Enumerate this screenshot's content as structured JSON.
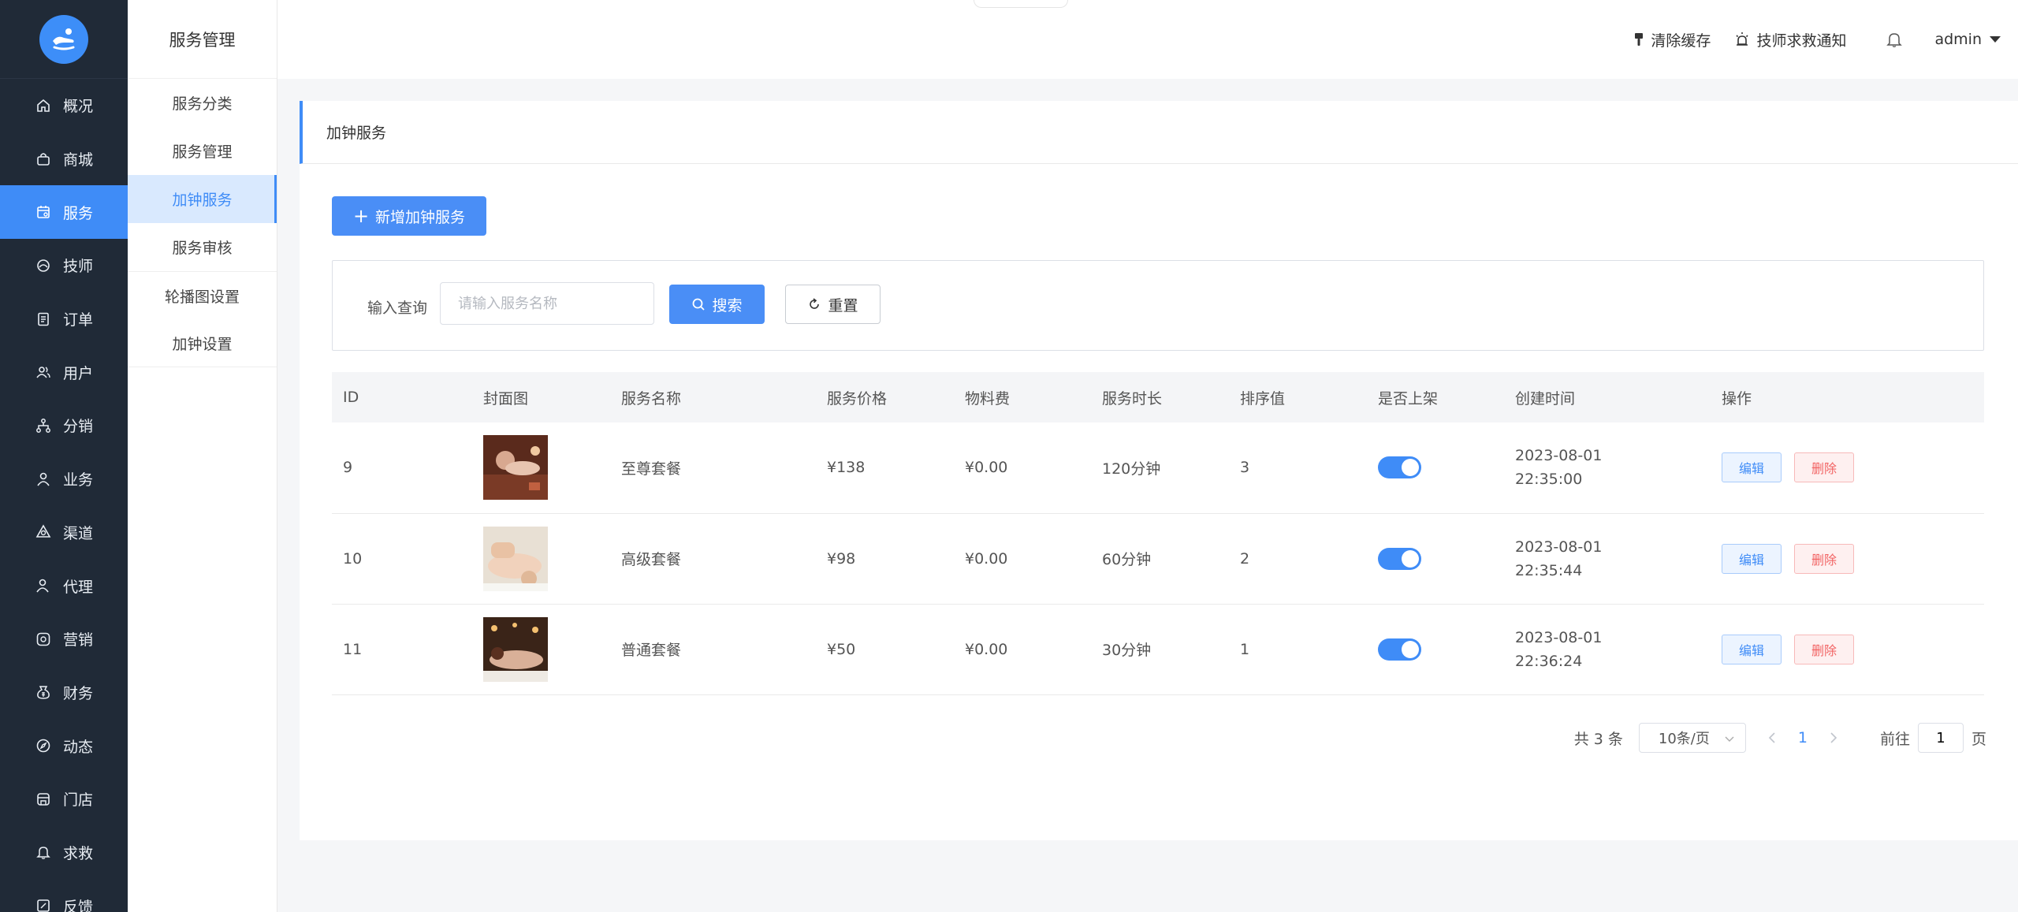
{
  "nav": {
    "items": [
      {
        "label": "概况",
        "icon": "home-icon"
      },
      {
        "label": "商城",
        "icon": "shop-bag-icon"
      },
      {
        "label": "服务",
        "icon": "service-calendar-icon"
      },
      {
        "label": "技师",
        "icon": "technician-icon"
      },
      {
        "label": "订单",
        "icon": "order-document-icon"
      },
      {
        "label": "用户",
        "icon": "users-icon"
      },
      {
        "label": "分销",
        "icon": "distribution-tree-icon"
      },
      {
        "label": "业务",
        "icon": "person-icon"
      },
      {
        "label": "渠道",
        "icon": "channel-icon"
      },
      {
        "label": "代理",
        "icon": "agent-icon"
      },
      {
        "label": "营销",
        "icon": "marketing-icon"
      },
      {
        "label": "财务",
        "icon": "finance-bag-icon"
      },
      {
        "label": "动态",
        "icon": "compass-icon"
      },
      {
        "label": "门店",
        "icon": "store-icon"
      },
      {
        "label": "求救",
        "icon": "bell-icon"
      },
      {
        "label": "反馈",
        "icon": "feedback-icon"
      }
    ],
    "active_index": 2,
    "accent": "#3f8cf7"
  },
  "subnav": {
    "title": "服务管理",
    "items": [
      "服务分类",
      "服务管理",
      "加钟服务",
      "服务审核",
      "轮播图设置",
      "加钟设置"
    ],
    "active_index": 2
  },
  "header": {
    "clear_cache": "清除缓存",
    "sos_notice": "技师求救通知",
    "user": "admin"
  },
  "card": {
    "title": "加钟服务",
    "add_button": "新增加钟服务",
    "search": {
      "label": "输入查询",
      "placeholder": "请输入服务名称",
      "search_button": "搜索",
      "reset_button": "重置"
    }
  },
  "table": {
    "columns": [
      "ID",
      "封面图",
      "服务名称",
      "服务价格",
      "物料费",
      "服务时长",
      "排序值",
      "是否上架",
      "创建时间",
      "操作"
    ],
    "rows": [
      {
        "id": "9",
        "name": "至尊套餐",
        "price": "¥138",
        "material": "¥0.00",
        "duration": "120分钟",
        "sort": "3",
        "on_shelf": true,
        "date": "2023-08-01",
        "time": "22:35:00"
      },
      {
        "id": "10",
        "name": "高级套餐",
        "price": "¥98",
        "material": "¥0.00",
        "duration": "60分钟",
        "sort": "2",
        "on_shelf": true,
        "date": "2023-08-01",
        "time": "22:35:44"
      },
      {
        "id": "11",
        "name": "普通套餐",
        "price": "¥50",
        "material": "¥0.00",
        "duration": "30分钟",
        "sort": "1",
        "on_shelf": true,
        "date": "2023-08-01",
        "time": "22:36:24"
      }
    ],
    "edit_label": "编辑",
    "delete_label": "删除"
  },
  "pager": {
    "total": "共 3 条",
    "page_size": "10条/页",
    "current_page": "1",
    "goto_prefix": "前往",
    "goto_value": "1",
    "goto_suffix": "页"
  }
}
